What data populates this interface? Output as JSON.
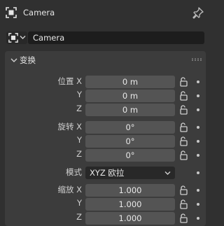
{
  "header": {
    "title": "Camera"
  },
  "object_selector": {
    "name": "Camera"
  },
  "transform": {
    "title": "变换",
    "location": {
      "label": "位置",
      "axes": [
        "X",
        "Y",
        "Z"
      ],
      "values": [
        "0 m",
        "0 m",
        "0 m"
      ]
    },
    "rotation": {
      "label": "旋转",
      "axes": [
        "X",
        "Y",
        "Z"
      ],
      "values": [
        "0°",
        "0°",
        "0°"
      ]
    },
    "mode": {
      "label": "模式",
      "value": "XYZ 欧拉"
    },
    "scale": {
      "label": "缩放",
      "axes": [
        "X",
        "Y",
        "Z"
      ],
      "values": [
        "1.000",
        "1.000",
        "1.000"
      ]
    }
  }
}
